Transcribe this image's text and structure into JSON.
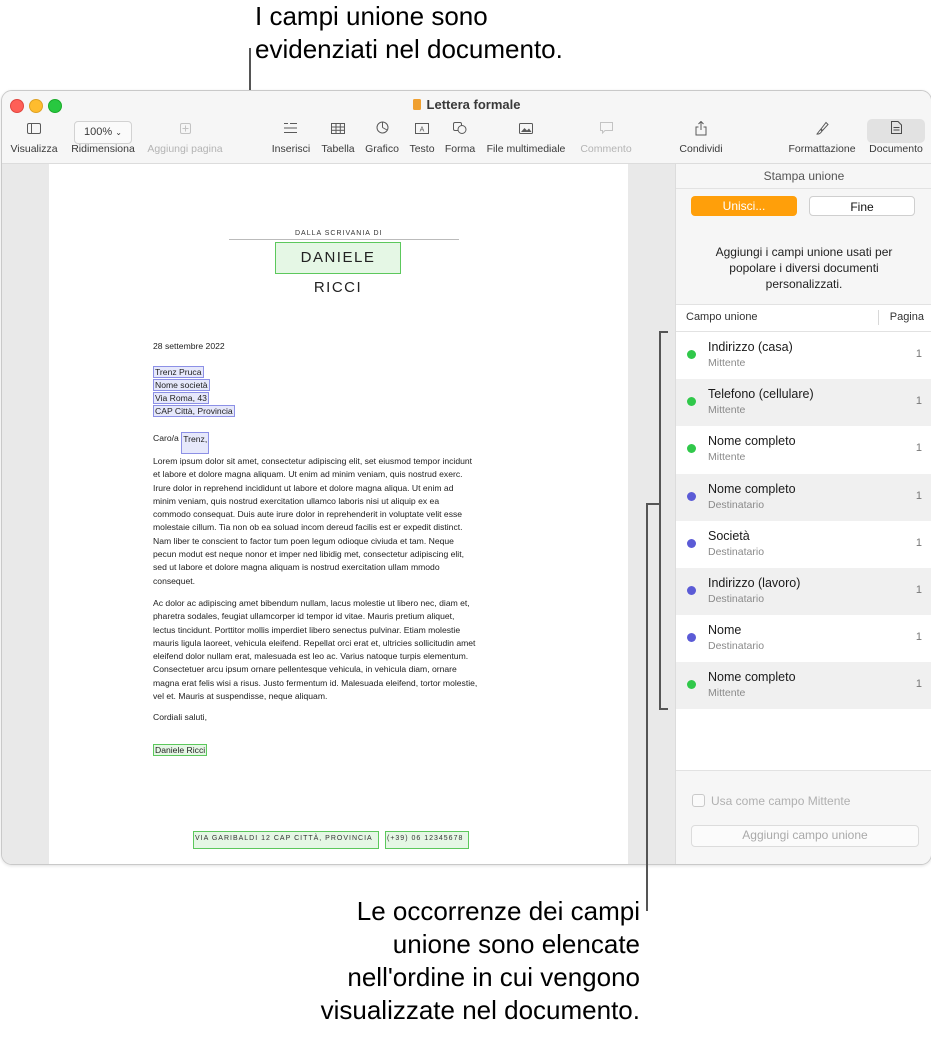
{
  "callouts": {
    "top_line1": "I campi unione sono",
    "top_line2": "evidenziati nel documento.",
    "bottom_line1": "Le occorrenze dei campi",
    "bottom_line2": "unione sono elencate",
    "bottom_line3": "nell'ordine in cui vengono",
    "bottom_line4": "visualizzate nel documento."
  },
  "window": {
    "title": "Lettera formale"
  },
  "toolbar": {
    "visualizza": "Visualizza",
    "ridimensiona": "Ridimensiona",
    "zoom_value": "100%",
    "aggiungi_pagina": "Aggiungi pagina",
    "inserisci": "Inserisci",
    "tabella": "Tabella",
    "grafico": "Grafico",
    "testo": "Testo",
    "forma": "Forma",
    "multimedia": "File multimediale",
    "commento": "Commento",
    "condividi": "Condividi",
    "formattazione": "Formattazione",
    "documento": "Documento"
  },
  "letter": {
    "header_small": "DALLA SCRIVANIA DI",
    "header_name": "DANIELE RICCI",
    "date": "28 settembre 2022",
    "addr1": "Trenz Pruca",
    "addr2": "Nome società",
    "addr3": "Via Roma, 43",
    "addr4": "CAP Città, Provincia",
    "greeting_prefix": "Caro/a ",
    "greeting_field": "Trenz,",
    "para1": [
      "Lorem ipsum dolor sit amet, consectetur adipiscing elit, set eiusmod tempor incidunt",
      "et labore et dolore magna aliquam. Ut enim ad minim veniam, quis nostrud exerc.",
      "Irure dolor in reprehend incididunt ut labore et dolore magna aliqua. Ut enim ad",
      "minim veniam, quis nostrud exercitation ullamco laboris nisi ut aliquip ex ea",
      "commodo consequat. Duis aute irure dolor in reprehenderit in voluptate velit esse",
      "molestaie cillum. Tia non ob ea soluad incom dereud facilis est er expedit distinct.",
      "Nam liber te conscient to factor tum poen legum odioque civiuda et tam. Neque",
      "pecun modut est neque nonor et imper ned libidig met, consectetur adipiscing elit,",
      "sed ut labore et dolore magna aliquam is nostrud exercitation ullam mmodo",
      "consequet."
    ],
    "para2": [
      "Ac dolor ac adipiscing amet bibendum nullam, lacus molestie ut libero nec, diam et,",
      "pharetra sodales, feugiat ullamcorper id tempor id vitae. Mauris pretium aliquet,",
      "lectus tincidunt. Porttitor mollis imperdiet libero senectus pulvinar. Etiam molestie",
      "mauris ligula laoreet, vehicula eleifend. Repellat orci erat et, ultricies sollicitudin amet",
      "eleifend dolor nullam erat, malesuada est leo ac. Varius natoque turpis elementum.",
      "Consectetuer arcu ipsum ornare pellentesque vehicula, in vehicula diam, ornare",
      "magna erat felis wisi a risus. Justo fermentum id. Malesuada eleifend, tortor molestie,",
      "vel et. Mauris at suspendisse, neque aliquam."
    ],
    "closing": "Cordiali saluti,",
    "signature": "Daniele Ricci",
    "footer_address": "VIA GARIBALDI 12   CAP CITTÀ, PROVINCIA",
    "footer_phone": "(+39) 06 12345678"
  },
  "sidebar": {
    "title": "Stampa unione",
    "unisci_label": "Unisci...",
    "fine_label": "Fine",
    "description": "Aggiungi i campi unione usati per popolare i diversi documenti personalizzati.",
    "col_campo": "Campo unione",
    "col_pagina": "Pagina",
    "fields": [
      {
        "name": "Indirizzo (casa)",
        "source": "Mittente",
        "page": "1",
        "color": "#30c84a"
      },
      {
        "name": "Telefono (cellulare)",
        "source": "Mittente",
        "page": "1",
        "color": "#30c84a"
      },
      {
        "name": "Nome completo",
        "source": "Mittente",
        "page": "1",
        "color": "#30c84a"
      },
      {
        "name": "Nome completo",
        "source": "Destinatario",
        "page": "1",
        "color": "#5b5bd6"
      },
      {
        "name": "Società",
        "source": "Destinatario",
        "page": "1",
        "color": "#5b5bd6"
      },
      {
        "name": "Indirizzo (lavoro)",
        "source": "Destinatario",
        "page": "1",
        "color": "#5b5bd6"
      },
      {
        "name": "Nome",
        "source": "Destinatario",
        "page": "1",
        "color": "#5b5bd6"
      },
      {
        "name": "Nome completo",
        "source": "Mittente",
        "page": "1",
        "color": "#30c84a"
      }
    ],
    "use_sender_label": "Usa come campo Mittente",
    "add_field_label": "Aggiungi campo unione"
  },
  "colors": {
    "accent_orange": "#ff9f0a",
    "sender_green": "#30c84a",
    "recipient_blue": "#5b5bd6"
  },
  "icons": {
    "visualizza": "sidebar-icon",
    "aggiungi_pagina": "plus-square-icon",
    "inserisci": "list-insert-icon",
    "tabella": "table-icon",
    "grafico": "pie-chart-icon",
    "testo": "text-box-icon",
    "forma": "shape-icon",
    "multimedia": "photo-icon",
    "commento": "comment-icon",
    "condividi": "share-icon",
    "formattazione": "paintbrush-icon",
    "documento": "document-icon"
  }
}
